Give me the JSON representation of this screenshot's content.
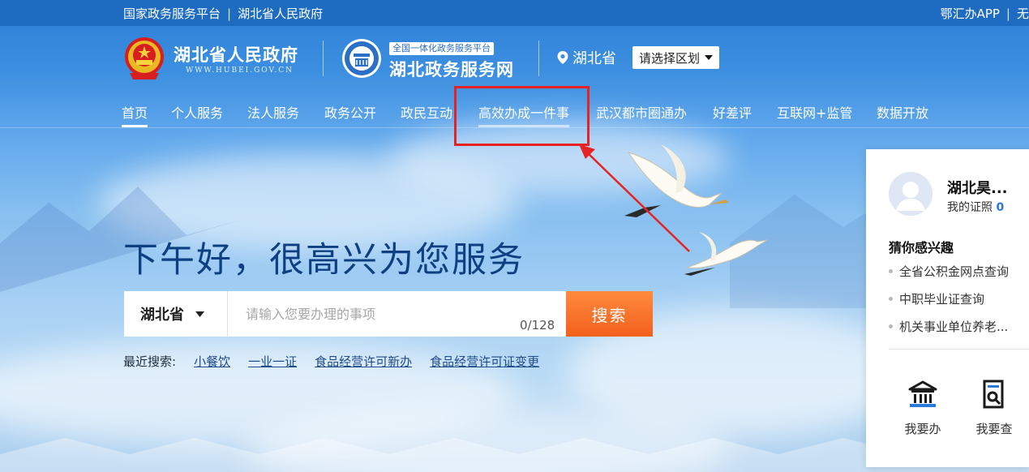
{
  "topbar": {
    "left_links": [
      "国家政务服务平台",
      "湖北省人民政府"
    ],
    "separator": "|",
    "right_links": [
      "鄂汇办APP",
      "无"
    ]
  },
  "header": {
    "gov_title": "湖北省人民政府",
    "gov_url": "WWW.HUBEI.GOV.CN",
    "svc_tag": "全国一体化政务服务平台",
    "svc_title": "湖北政务服务网",
    "location": "湖北省",
    "region_select": "请选择区划"
  },
  "nav": {
    "items": [
      "首页",
      "个人服务",
      "法人服务",
      "政务公开",
      "政民互动",
      "高效办成一件事",
      "武汉都市圈通办",
      "好差评",
      "互联网+监管",
      "数据开放"
    ]
  },
  "main": {
    "greeting": "下午好，很高兴为您服务",
    "search": {
      "region": "湖北省",
      "placeholder": "请输入您要办理的事项",
      "counter": "0/128",
      "button": "搜索"
    },
    "recent": {
      "label": "最近搜索:",
      "items": [
        "小餐饮",
        "一业一证",
        "食品经营许可新办",
        "食品经营许可证变更"
      ]
    }
  },
  "panel": {
    "user_name": "湖北昊...",
    "cert_label": "我的证照",
    "cert_count": "0",
    "guess_title": "猜你感兴趣",
    "guess_items": [
      "全省公积金网点查询",
      "中职毕业证查询",
      "机关事业单位养老..."
    ],
    "actions": [
      {
        "label": "我要办",
        "icon": "bank-building-icon"
      },
      {
        "label": "我要查",
        "icon": "document-search-icon"
      }
    ]
  },
  "colors": {
    "topbar": "#1e6cc2",
    "greeting": "#0d3f82",
    "search_button": "#f2601c",
    "highlight_box": "#e62222",
    "accent_blue": "#2a78d8"
  }
}
